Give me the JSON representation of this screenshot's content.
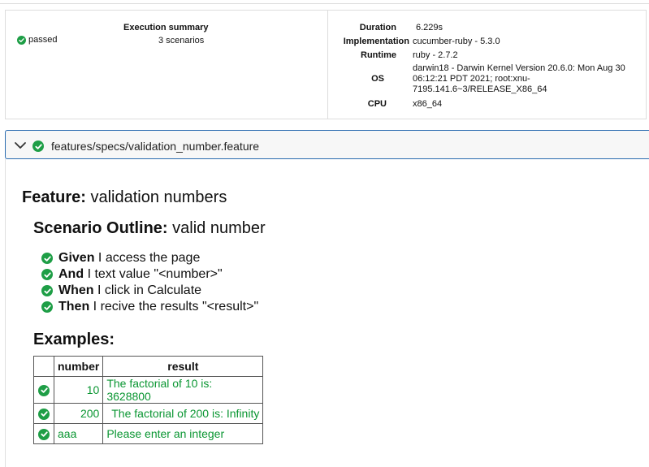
{
  "summary": {
    "title": "Execution summary",
    "status": "passed",
    "scenarios": "3 scenarios",
    "meta": [
      {
        "key": "Duration",
        "value": "6.229s"
      },
      {
        "key": "Implementation",
        "value": "cucumber-ruby - 5.3.0"
      },
      {
        "key": "Runtime",
        "value": "ruby - 2.7.2"
      },
      {
        "key": "OS",
        "value": "darwin18 - Darwin Kernel Version 20.6.0: Mon Aug 30 06:12:21 PDT 2021; root:xnu-7195.141.6~3/RELEASE_X86_64"
      },
      {
        "key": "CPU",
        "value": "x86_64"
      }
    ]
  },
  "feature_file": {
    "path": "features/specs/validation_number.feature"
  },
  "feature": {
    "keyword": "Feature:",
    "name": "validation numbers"
  },
  "scenario": {
    "keyword": "Scenario Outline:",
    "name": "valid number"
  },
  "steps": [
    {
      "keyword": "Given",
      "text": "I access the page"
    },
    {
      "keyword": "And",
      "text": "I text value \"<number>\""
    },
    {
      "keyword": "When",
      "text": "I click in Calculate"
    },
    {
      "keyword": "Then",
      "text": "I recive the results \"<result>\""
    }
  ],
  "examples": {
    "title": "Examples:",
    "headers": [
      "number",
      "result"
    ],
    "rows": [
      {
        "number": "10",
        "result": "The factorial of 10 is: 3628800"
      },
      {
        "number": "200",
        "result": "The factorial of 200 is: Infinity"
      },
      {
        "number": "aaa",
        "result": "Please enter an integer"
      }
    ]
  },
  "colors": {
    "pass": "#1e9e46",
    "accent": "#2b6cb0"
  }
}
